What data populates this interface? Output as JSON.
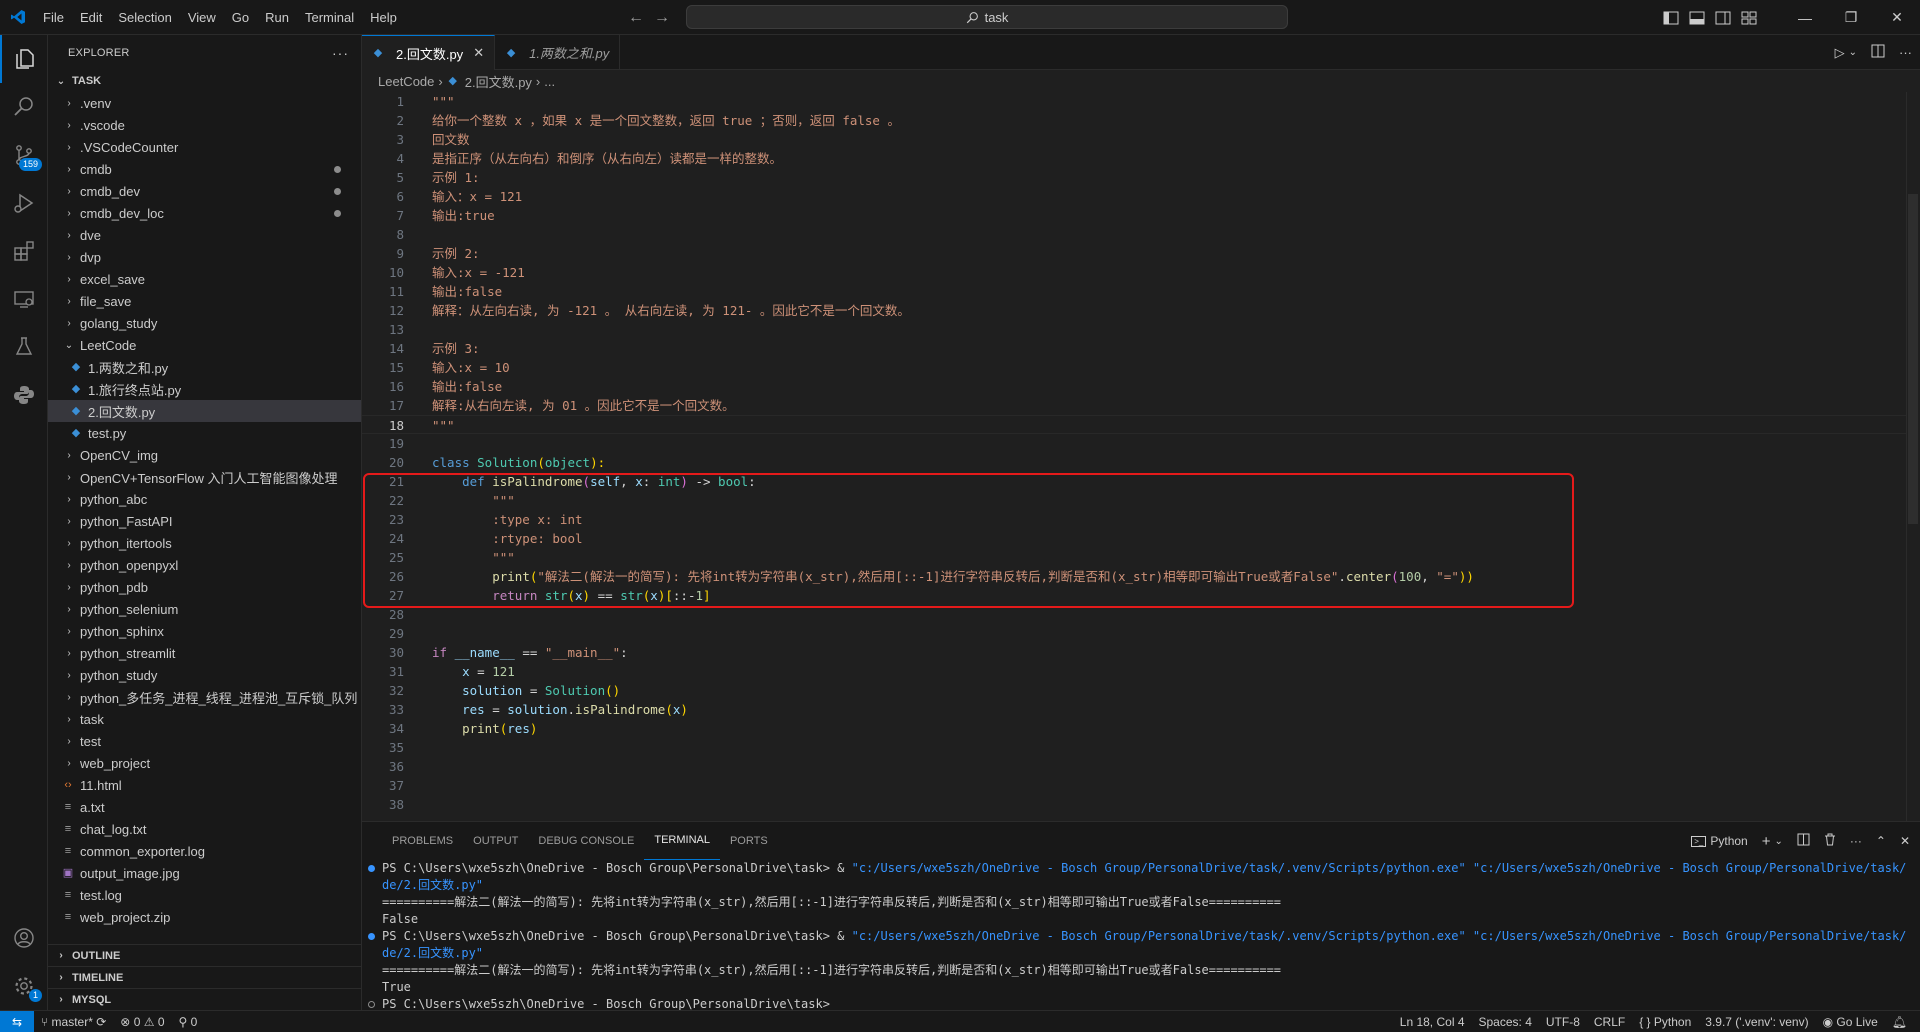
{
  "titlebar": {
    "menus": [
      "File",
      "Edit",
      "Selection",
      "View",
      "Go",
      "Run",
      "Terminal",
      "Help"
    ],
    "search_text": "task"
  },
  "activity": {
    "scm_badge": "159",
    "settings_badge": "1"
  },
  "sidebar": {
    "title": "EXPLORER",
    "root": "TASK",
    "items": [
      {
        "label": ".venv",
        "type": "folder",
        "depth": 0
      },
      {
        "label": ".vscode",
        "type": "folder",
        "depth": 0
      },
      {
        "label": ".VSCodeCounter",
        "type": "folder",
        "depth": 0
      },
      {
        "label": "cmdb",
        "type": "folder",
        "depth": 0,
        "modified": true
      },
      {
        "label": "cmdb_dev",
        "type": "folder",
        "depth": 0,
        "modified": true
      },
      {
        "label": "cmdb_dev_loc",
        "type": "folder",
        "depth": 0,
        "modified": true
      },
      {
        "label": "dve",
        "type": "folder",
        "depth": 0
      },
      {
        "label": "dvp",
        "type": "folder",
        "depth": 0
      },
      {
        "label": "excel_save",
        "type": "folder",
        "depth": 0
      },
      {
        "label": "file_save",
        "type": "folder",
        "depth": 0
      },
      {
        "label": "golang_study",
        "type": "folder",
        "depth": 0
      },
      {
        "label": "LeetCode",
        "type": "folder-open",
        "depth": 0
      },
      {
        "label": "1.两数之和.py",
        "type": "py",
        "depth": 1
      },
      {
        "label": "1.旅行终点站.py",
        "type": "py",
        "depth": 1
      },
      {
        "label": "2.回文数.py",
        "type": "py",
        "depth": 1,
        "selected": true
      },
      {
        "label": "test.py",
        "type": "py",
        "depth": 1
      },
      {
        "label": "OpenCV_img",
        "type": "folder",
        "depth": 0
      },
      {
        "label": "OpenCV+TensorFlow 入门人工智能图像处理",
        "type": "folder",
        "depth": 0
      },
      {
        "label": "python_abc",
        "type": "folder",
        "depth": 0
      },
      {
        "label": "python_FastAPI",
        "type": "folder",
        "depth": 0
      },
      {
        "label": "python_itertools",
        "type": "folder",
        "depth": 0
      },
      {
        "label": "python_openpyxl",
        "type": "folder",
        "depth": 0
      },
      {
        "label": "python_pdb",
        "type": "folder",
        "depth": 0
      },
      {
        "label": "python_selenium",
        "type": "folder",
        "depth": 0
      },
      {
        "label": "python_sphinx",
        "type": "folder",
        "depth": 0
      },
      {
        "label": "python_streamlit",
        "type": "folder",
        "depth": 0
      },
      {
        "label": "python_study",
        "type": "folder",
        "depth": 0
      },
      {
        "label": "python_多任务_进程_线程_进程池_互斥锁_队列",
        "type": "folder",
        "depth": 0
      },
      {
        "label": "task",
        "type": "folder",
        "depth": 0
      },
      {
        "label": "test",
        "type": "folder",
        "depth": 0
      },
      {
        "label": "web_project",
        "type": "folder",
        "depth": 0
      },
      {
        "label": "11.html",
        "type": "html",
        "depth": 0
      },
      {
        "label": "a.txt",
        "type": "txt",
        "depth": 0
      },
      {
        "label": "chat_log.txt",
        "type": "txt",
        "depth": 0
      },
      {
        "label": "common_exporter.log",
        "type": "txt",
        "depth": 0
      },
      {
        "label": "output_image.jpg",
        "type": "img",
        "depth": 0
      },
      {
        "label": "test.log",
        "type": "txt",
        "depth": 0
      },
      {
        "label": "web_project.zip",
        "type": "txt",
        "depth": 0
      }
    ],
    "sections": [
      "OUTLINE",
      "TIMELINE",
      "MYSQL"
    ]
  },
  "editor": {
    "tabs": [
      {
        "label": "2.回文数.py",
        "active": true
      },
      {
        "label": "1.两数之和.py",
        "active": false
      }
    ],
    "breadcrumb": [
      "LeetCode",
      "2.回文数.py",
      "..."
    ],
    "current_line": 18,
    "lines": [
      [
        [
          "\"\"\"",
          "c-str"
        ]
      ],
      [
        [
          "给你一个整数 x ，如果 x 是一个回文整数，返回 true ；否则，返回 false 。",
          "c-str"
        ]
      ],
      [
        [
          "回文数",
          "c-str"
        ]
      ],
      [
        [
          "是指正序（从左向右）和倒序（从右向左）读都是一样的整数。",
          "c-str"
        ]
      ],
      [
        [
          "示例 1:",
          "c-str"
        ]
      ],
      [
        [
          "输入：x = 121",
          "c-str"
        ]
      ],
      [
        [
          "输出:true",
          "c-str"
        ]
      ],
      [
        [
          "",
          "c-str"
        ]
      ],
      [
        [
          "示例 2:",
          "c-str"
        ]
      ],
      [
        [
          "输入:x = -121",
          "c-str"
        ]
      ],
      [
        [
          "输出:false",
          "c-str"
        ]
      ],
      [
        [
          "解释：从左向右读, 为 -121 。 从右向左读, 为 121- 。因此它不是一个回文数。",
          "c-str"
        ]
      ],
      [
        [
          "",
          "c-str"
        ]
      ],
      [
        [
          "示例 3:",
          "c-str"
        ]
      ],
      [
        [
          "输入:x = 10",
          "c-str"
        ]
      ],
      [
        [
          "输出:false",
          "c-str"
        ]
      ],
      [
        [
          "解释:从右向左读, 为 01 。因此它不是一个回文数。",
          "c-str"
        ]
      ],
      [
        [
          "\"\"\"",
          "c-str"
        ]
      ],
      [],
      [
        [
          "class ",
          "c-kw"
        ],
        [
          "Solution",
          "c-cls"
        ],
        [
          "(",
          "c-br1"
        ],
        [
          "object",
          "c-cls"
        ],
        [
          "):",
          "c-br1"
        ]
      ],
      [
        [
          "    ",
          "c-plain"
        ],
        [
          "def ",
          "c-kw"
        ],
        [
          "isPalindrome",
          "c-fn"
        ],
        [
          "(",
          "c-br2"
        ],
        [
          "self",
          "c-var"
        ],
        [
          ", ",
          "c-op"
        ],
        [
          "x",
          "c-var"
        ],
        [
          ": ",
          "c-op"
        ],
        [
          "int",
          "c-cls"
        ],
        [
          ")",
          "c-br2"
        ],
        [
          " -> ",
          "c-op"
        ],
        [
          "bool",
          "c-cls"
        ],
        [
          ":",
          "c-op"
        ]
      ],
      [
        [
          "        \"\"\"",
          "c-str"
        ]
      ],
      [
        [
          "        :type x: int",
          "c-str"
        ]
      ],
      [
        [
          "        :rtype: bool",
          "c-str"
        ]
      ],
      [
        [
          "        \"\"\"",
          "c-str"
        ]
      ],
      [
        [
          "        ",
          "c-plain"
        ],
        [
          "print",
          "c-fn"
        ],
        [
          "(",
          "c-br1"
        ],
        [
          "\"解法二(解法一的简写): 先将int转为字符串(x_str),然后用[::-1]进行字符串反转后,判断是否和(x_str)相等即可输出True或者False\"",
          "c-str"
        ],
        [
          ".",
          "c-op"
        ],
        [
          "center",
          "c-fn"
        ],
        [
          "(",
          "c-br2"
        ],
        [
          "100",
          "c-num"
        ],
        [
          ", ",
          "c-op"
        ],
        [
          "\"=\"",
          "c-str"
        ],
        [
          "))",
          "c-br1"
        ]
      ],
      [
        [
          "        ",
          "c-plain"
        ],
        [
          "return ",
          "c-ctl"
        ],
        [
          "str",
          "c-cls"
        ],
        [
          "(",
          "c-br1"
        ],
        [
          "x",
          "c-var"
        ],
        [
          ")",
          "c-br1"
        ],
        [
          " == ",
          "c-op"
        ],
        [
          "str",
          "c-cls"
        ],
        [
          "(",
          "c-br1"
        ],
        [
          "x",
          "c-var"
        ],
        [
          ")",
          "c-br1"
        ],
        [
          "[",
          "c-br1"
        ],
        [
          "::-",
          "c-op"
        ],
        [
          "1",
          "c-num"
        ],
        [
          "]",
          "c-br1"
        ]
      ],
      [],
      [],
      [
        [
          "if ",
          "c-ctl"
        ],
        [
          "__name__",
          "c-var"
        ],
        [
          " == ",
          "c-op"
        ],
        [
          "\"__main__\"",
          "c-str"
        ],
        [
          ":",
          "c-op"
        ]
      ],
      [
        [
          "    ",
          "c-plain"
        ],
        [
          "x",
          "c-var"
        ],
        [
          " = ",
          "c-op"
        ],
        [
          "121",
          "c-num"
        ]
      ],
      [
        [
          "    ",
          "c-plain"
        ],
        [
          "solution",
          "c-var"
        ],
        [
          " = ",
          "c-op"
        ],
        [
          "Solution",
          "c-cls"
        ],
        [
          "()",
          "c-br1"
        ]
      ],
      [
        [
          "    ",
          "c-plain"
        ],
        [
          "res",
          "c-var"
        ],
        [
          " = ",
          "c-op"
        ],
        [
          "solution",
          "c-var"
        ],
        [
          ".",
          "c-op"
        ],
        [
          "isPalindrome",
          "c-fn"
        ],
        [
          "(",
          "c-br1"
        ],
        [
          "x",
          "c-var"
        ],
        [
          ")",
          "c-br1"
        ]
      ],
      [
        [
          "    ",
          "c-plain"
        ],
        [
          "print",
          "c-fn"
        ],
        [
          "(",
          "c-br1"
        ],
        [
          "res",
          "c-var"
        ],
        [
          ")",
          "c-br1"
        ]
      ],
      [],
      [],
      [],
      []
    ]
  },
  "panel": {
    "tabs": [
      "PROBLEMS",
      "OUTPUT",
      "DEBUG CONSOLE",
      "TERMINAL",
      "PORTS"
    ],
    "active_tab": "TERMINAL",
    "terminal_profile": "Python",
    "lines": [
      {
        "marker": "blue",
        "parts": [
          [
            "PS C:\\Users\\wxe5szh\\OneDrive - Bosch Group\\PersonalDrive\\task> & ",
            "t-amp"
          ],
          [
            "\"c:/Users/wxe5szh/OneDrive - Bosch Group/PersonalDrive/task/.venv/Scripts/python.exe\" \"c:/Users/wxe5szh/OneDrive - Bosch Group/PersonalDrive/task/LeetCo",
            "t-path"
          ]
        ]
      },
      {
        "marker": "",
        "parts": [
          [
            "de/2.回文数.py\"",
            "t-path"
          ]
        ]
      },
      {
        "marker": "",
        "parts": [
          [
            "==========解法二(解法一的简写): 先将int转为字符串(x_str),然后用[::-1]进行字符串反转后,判断是否和(x_str)相等即可输出True或者False==========",
            "t-amp"
          ]
        ]
      },
      {
        "marker": "",
        "parts": [
          [
            "False",
            "t-amp"
          ]
        ]
      },
      {
        "marker": "blue",
        "parts": [
          [
            "PS C:\\Users\\wxe5szh\\OneDrive - Bosch Group\\PersonalDrive\\task> & ",
            "t-amp"
          ],
          [
            "\"c:/Users/wxe5szh/OneDrive - Bosch Group/PersonalDrive/task/.venv/Scripts/python.exe\" \"c:/Users/wxe5szh/OneDrive - Bosch Group/PersonalDrive/task/LeetCo",
            "t-path"
          ]
        ]
      },
      {
        "marker": "",
        "parts": [
          [
            "de/2.回文数.py\"",
            "t-path"
          ]
        ]
      },
      {
        "marker": "",
        "parts": [
          [
            "==========解法二(解法一的简写): 先将int转为字符串(x_str),然后用[::-1]进行字符串反转后,判断是否和(x_str)相等即可输出True或者False==========",
            "t-amp"
          ]
        ]
      },
      {
        "marker": "",
        "parts": [
          [
            "True",
            "t-amp"
          ]
        ]
      },
      {
        "marker": "grey",
        "parts": [
          [
            "PS C:\\Users\\wxe5szh\\OneDrive - Bosch Group\\PersonalDrive\\task>",
            "t-amp"
          ]
        ]
      }
    ]
  },
  "statusbar": {
    "branch": "master*",
    "errors": "0",
    "warnings": "0",
    "ports": "0",
    "position": "Ln 18, Col 4",
    "spaces": "Spaces: 4",
    "encoding": "UTF-8",
    "eol": "CRLF",
    "language": "Python",
    "interpreter": "3.9.7 ('.venv': venv)",
    "golive": "Go Live"
  },
  "colors": {
    "accent": "#0078d4",
    "annotation_red": "#e51a1a"
  }
}
